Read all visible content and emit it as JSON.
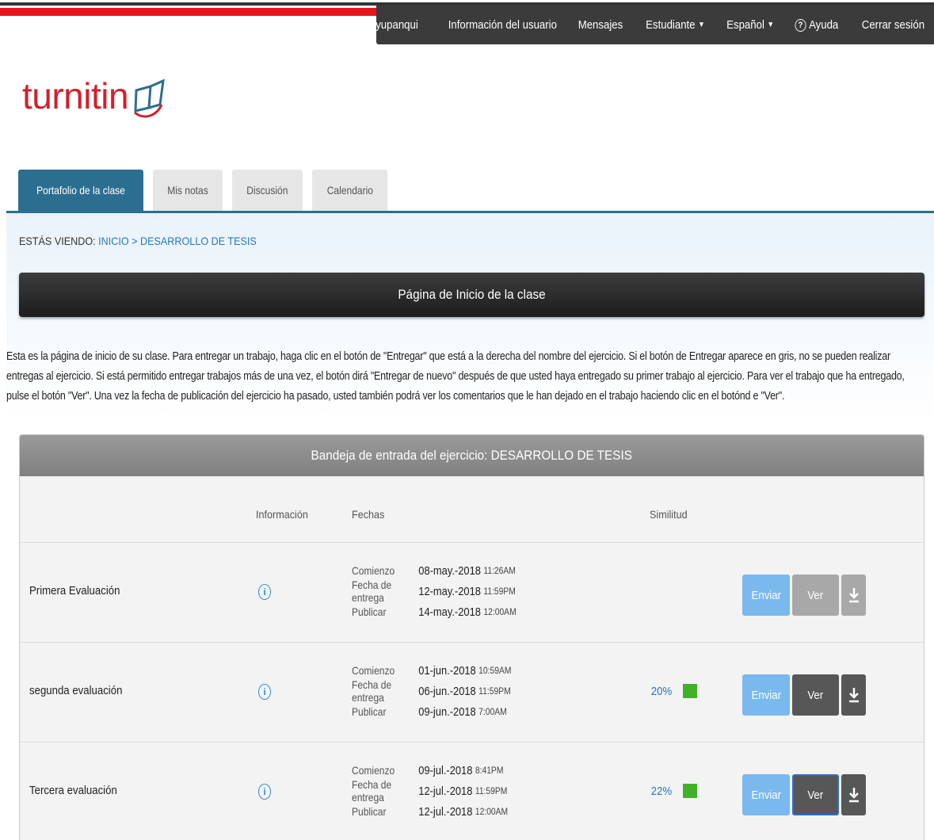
{
  "topnav": {
    "items": [
      {
        "label": "clinton dani ramos yupanqui"
      },
      {
        "label": "Información del usuario"
      },
      {
        "label": "Mensajes"
      },
      {
        "label": "Estudiante",
        "dropdown": true
      },
      {
        "label": "Español",
        "dropdown": true
      },
      {
        "label": "Ayuda",
        "icon": "help-icon"
      },
      {
        "label": "Cerrar sesión"
      }
    ]
  },
  "logo": {
    "text": "turnitin"
  },
  "tabs": [
    {
      "label": "Portafolio de la clase",
      "active": true
    },
    {
      "label": "Mis notas"
    },
    {
      "label": "Discusión"
    },
    {
      "label": "Calendario"
    }
  ],
  "breadcrumb": {
    "prefix": "ESTÁS VIENDO:",
    "home": "INICIO",
    "separator": ">",
    "current": "DESARROLLO DE TESIS"
  },
  "banner": {
    "title": "Página de Inicio de la clase"
  },
  "intro": "Esta es la página de inicio de su clase. Para entregar un trabajo, haga clic en el botón de \"Entregar\" que está a la derecha del nombre del ejercicio. Si el botón de Entregar aparece en gris, no se pueden realizar entregas al ejercicio. Si está permitido entregar trabajos más de una vez, el botón dirá \"Entregar de nuevo\" después de que usted haya entregado su primer trabajo al ejercicio. Para ver el trabajo que ha entregado, pulse el botón \"Ver\". Una vez la fecha de publicación del ejercicio ha pasado, usted también podrá ver los comentarios que le han dejado en el trabajo haciendo clic en el botónd e \"Ver\".",
  "inbox": {
    "title": "Bandeja de entrada del ejercicio: DESARROLLO DE TESIS",
    "columns": {
      "info": "Información",
      "dates": "Fechas",
      "similarity": "Similitud"
    },
    "date_labels": {
      "start": "Comienzo",
      "due": "Fecha de entrega",
      "post": "Publicar"
    },
    "buttons": {
      "submit": "Enviar",
      "view": "Ver"
    },
    "rows": [
      {
        "name": "Primera Evaluación",
        "start_date": "08-may.-2018",
        "start_time": "11:26AM",
        "due_date": "12-may.-2018",
        "due_time": "11:59PM",
        "post_date": "14-may.-2018",
        "post_time": "12:00AM",
        "similarity": "",
        "view_enabled": false
      },
      {
        "name": "segunda evaluación",
        "start_date": "01-jun.-2018",
        "start_time": "10:59AM",
        "due_date": "06-jun.-2018",
        "due_time": "11:59PM",
        "post_date": "09-jun.-2018",
        "post_time": "7:00AM",
        "similarity": "20%",
        "view_enabled": true
      },
      {
        "name": "Tercera evaluación",
        "start_date": "09-jul.-2018",
        "start_time": "8:41PM",
        "due_date": "12-jul.-2018",
        "due_time": "11:59PM",
        "post_date": "12-jul.-2018",
        "post_time": "12:00AM",
        "similarity": "22%",
        "view_enabled": true
      }
    ]
  },
  "colors": {
    "brand_red": "#d1202d",
    "tab_active": "#2c6e8f",
    "link": "#2479b8",
    "similarity_ok": "#43b02a"
  }
}
